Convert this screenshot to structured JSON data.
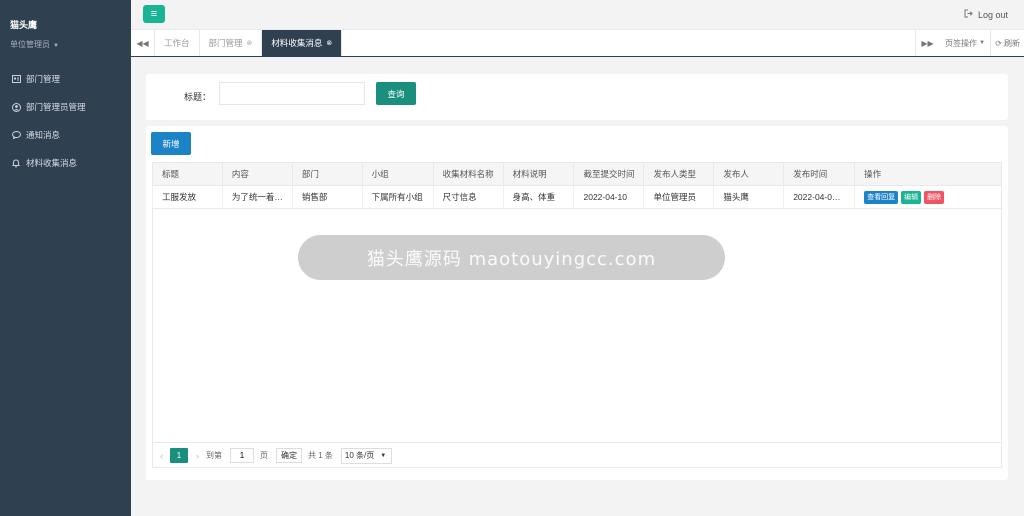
{
  "sidebar": {
    "user_name": "猫头鹰",
    "user_role": "单位管理员",
    "items": [
      {
        "label": "部门管理",
        "icon": "id-card-icon"
      },
      {
        "label": "部门管理员管理",
        "icon": "user-circle-icon"
      },
      {
        "label": "通知消息",
        "icon": "chat-bubble-icon"
      },
      {
        "label": "材料收集消息",
        "icon": "bell-icon"
      }
    ]
  },
  "topbar": {
    "logout_label": "Log out"
  },
  "tabs": {
    "items": [
      {
        "label": "工作台"
      },
      {
        "label": "部门管理"
      },
      {
        "label": "材料收集消息"
      }
    ],
    "page_ops_label": "页签操作",
    "refresh_label": "刷新"
  },
  "search": {
    "label": "标题：",
    "value": "",
    "button": "查询"
  },
  "table": {
    "add_button": "新增",
    "columns": [
      "标题",
      "内容",
      "部门",
      "小组",
      "收集材料名称",
      "材料说明",
      "截至提交时间",
      "发布人类型",
      "发布人",
      "发布时间",
      "操作"
    ],
    "rows": [
      [
        "工服发放",
        "为了统一着…",
        "销售部",
        "下属所有小组",
        "尺寸信息",
        "身高、体重",
        "2022-04-10",
        "单位管理员",
        "猫头鹰",
        "2022-04-0…"
      ]
    ],
    "actions": {
      "view": "查看回复",
      "edit": "编辑",
      "delete": "删除"
    }
  },
  "pager": {
    "current_page": "1",
    "goto_label": "到第",
    "goto_value": "1",
    "page_unit": "页",
    "confirm": "确定",
    "total": "共 1 条",
    "page_size": "10 条/页"
  },
  "watermark": "猫头鹰源码 maotouyingcc.com"
}
